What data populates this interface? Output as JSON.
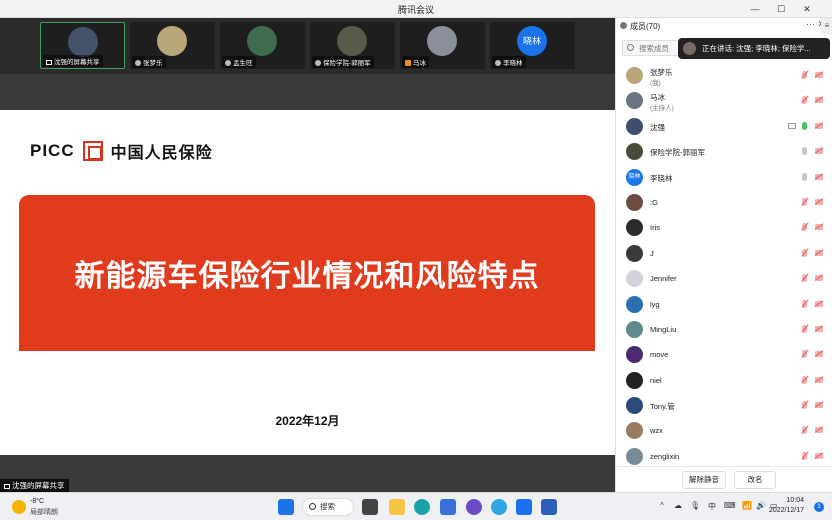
{
  "window": {
    "title": "腾讯会议"
  },
  "tiles": [
    {
      "name": "沈强的屏幕共享",
      "color": "#44536b"
    },
    {
      "name": "张梦乐",
      "color": "#b9a77a"
    },
    {
      "name": "孟生旺",
      "color": "#3f6b4f"
    },
    {
      "name": "保险学院-郭丽军",
      "color": "#5a5a4a"
    },
    {
      "name": "马冰",
      "color": "#8a8f99"
    },
    {
      "name": "李晓林",
      "initials": "晓林",
      "color": "#1a73e8"
    }
  ],
  "slide": {
    "logo_picc": "PICC",
    "logo_cn": "中国人民保险",
    "headline": "新能源车保险行业情况和风险特点",
    "date": "2022年12月"
  },
  "share_label": "沈强的屏幕共享",
  "panel": {
    "title": "成员(70)",
    "search_placeholder": "搜索成员",
    "speaking": "正在讲话: 沈强; 李晓林; 保险学...",
    "members": [
      {
        "name": "张梦乐",
        "sub": "(我)",
        "color": "#b9a77a"
      },
      {
        "name": "马冰",
        "sub": "(主持人)",
        "color": "#6b7280"
      },
      {
        "name": "沈强",
        "color": "#3b4f6e",
        "screen": true,
        "mic": "on"
      },
      {
        "name": "保险学院-郭丽军",
        "color": "#4a4a3a",
        "mic": "gray"
      },
      {
        "name": "李晓林",
        "initials": "晓林",
        "color": "#1a73e8",
        "mic": "gray"
      },
      {
        "name": ":G",
        "color": "#6d4c41"
      },
      {
        "name": "Iris",
        "color": "#2a2a2a"
      },
      {
        "name": "J",
        "color": "#3a3a3a"
      },
      {
        "name": "Jennifer",
        "color": "#d0d4dc"
      },
      {
        "name": "lyg",
        "color": "#2a6fb0"
      },
      {
        "name": "MingLiu",
        "color": "#5d8a8a"
      },
      {
        "name": "move",
        "color": "#4b2a6e"
      },
      {
        "name": "niel",
        "color": "#222222"
      },
      {
        "name": "Tony.管",
        "color": "#2c4a7a"
      },
      {
        "name": "wzx",
        "color": "#9a7b62"
      },
      {
        "name": "zenglixin",
        "color": "#7a8a99"
      }
    ],
    "unmute_all": "解除静音",
    "rename": "改名"
  },
  "taskbar": {
    "temp": "-8°C",
    "condition": "局部晴朗",
    "search": "搜索",
    "ime": "中",
    "time": "10:04",
    "date": "2022/12/17",
    "notifications": "1"
  }
}
